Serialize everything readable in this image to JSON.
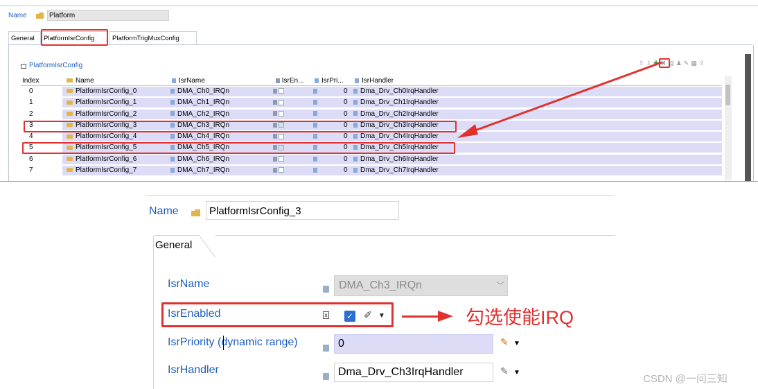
{
  "top": {
    "name_label": "Name",
    "name_value": "Platform",
    "tabs": [
      "General",
      "PlatformIsrConfig",
      "PlatformTrigMuxConfig"
    ],
    "table_title": "PlatformIsrConfig",
    "toolbar_icons": [
      "up-arrow-icon",
      "down-arrow-icon",
      "add-icon",
      "delete-icon",
      "copy-icon",
      "user-icon",
      "edit-icon",
      "table-icon",
      "export-icon"
    ],
    "columns": [
      "Index",
      "Name",
      "IsrName",
      "IsrEn...",
      "IsrPri...",
      "IsrHandler"
    ],
    "rows": [
      {
        "index": "0",
        "name": "PlatformIsrConfig_0",
        "isr": "DMA_Ch0_IRQn",
        "enabled": false,
        "prio": "0",
        "handler": "Dma_Drv_Ch0IrqHandler"
      },
      {
        "index": "1",
        "name": "PlatformIsrConfig_1",
        "isr": "DMA_Ch1_IRQn",
        "enabled": false,
        "prio": "0",
        "handler": "Dma_Drv_Ch1IrqHandler"
      },
      {
        "index": "2",
        "name": "PlatformIsrConfig_2",
        "isr": "DMA_Ch2_IRQn",
        "enabled": false,
        "prio": "0",
        "handler": "Dma_Drv_Ch2IrqHandler"
      },
      {
        "index": "3",
        "name": "PlatformIsrConfig_3",
        "isr": "DMA_Ch3_IRQn",
        "enabled": true,
        "prio": "0",
        "handler": "Dma_Drv_Ch3IrqHandler"
      },
      {
        "index": "4",
        "name": "PlatformIsrConfig_4",
        "isr": "DMA_Ch4_IRQn",
        "enabled": false,
        "prio": "0",
        "handler": "Dma_Drv_Ch4IrqHandler"
      },
      {
        "index": "5",
        "name": "PlatformIsrConfig_5",
        "isr": "DMA_Ch5_IRQn",
        "enabled": true,
        "prio": "0",
        "handler": "Dma_Drv_Ch5IrqHandler"
      },
      {
        "index": "6",
        "name": "PlatformIsrConfig_6",
        "isr": "DMA_Ch6_IRQn",
        "enabled": false,
        "prio": "0",
        "handler": "Dma_Drv_Ch6IrqHandler"
      },
      {
        "index": "7",
        "name": "PlatformIsrConfig_7",
        "isr": "DMA_Ch7_IRQn",
        "enabled": false,
        "prio": "0",
        "handler": "Dma_Drv_Ch7IrqHandler"
      }
    ]
  },
  "detail": {
    "name_label": "Name",
    "name_value": "PlatformIsrConfig_3",
    "tab": "General",
    "fields": {
      "isr_name": {
        "label": "IsrName",
        "value": "DMA_Ch3_IRQn"
      },
      "isr_enabled": {
        "label": "IsrEnabled",
        "checked": true
      },
      "isr_priority": {
        "label": "IsrPriority (dynamic range)",
        "value": "0"
      },
      "isr_handler": {
        "label": "IsrHandler",
        "value": "Dma_Drv_Ch3IrqHandler"
      }
    },
    "annotation": "勾选使能IRQ"
  },
  "watermark": "CSDN @一问三知",
  "colors": {
    "highlight": "#e0312f",
    "label": "#1f5fbf",
    "row_fill": "#dcdcf7"
  }
}
